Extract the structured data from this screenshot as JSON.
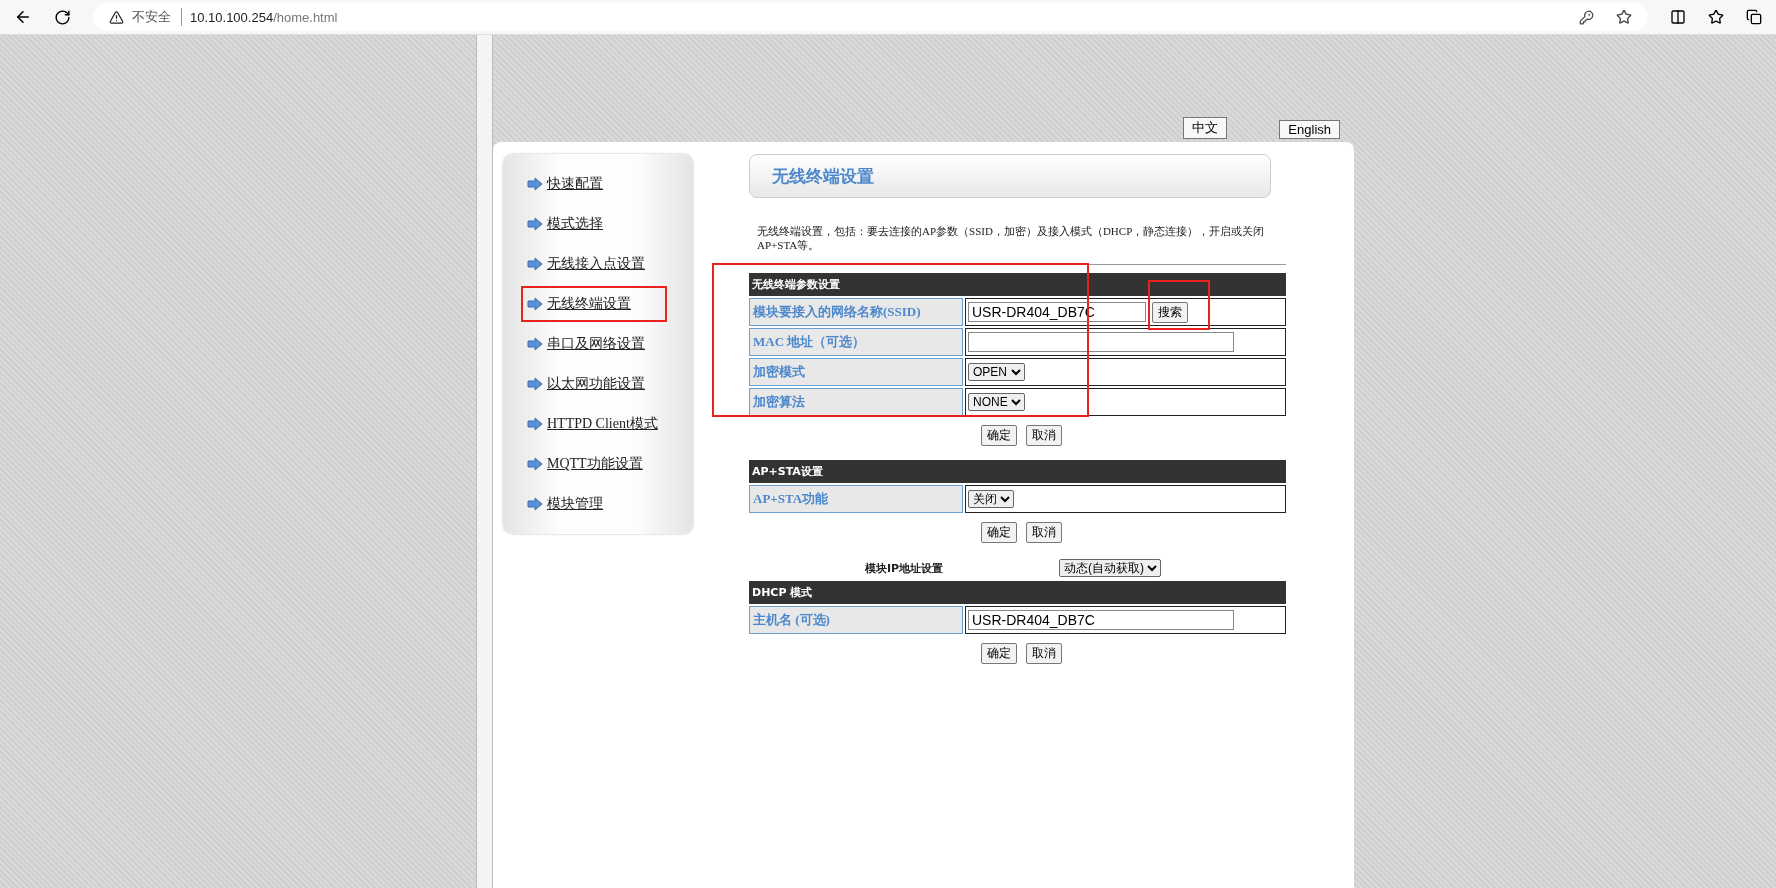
{
  "browser": {
    "security_label": "不安全",
    "url_host": "10.10.100.254",
    "url_path": "/home.html"
  },
  "language_buttons": [
    "中文",
    "English"
  ],
  "sidebar": {
    "items": [
      {
        "label": "快速配置",
        "highlighted": false
      },
      {
        "label": "模式选择",
        "highlighted": false
      },
      {
        "label": "无线接入点设置",
        "highlighted": false
      },
      {
        "label": "无线终端设置",
        "highlighted": true
      },
      {
        "label": "串口及网络设置",
        "highlighted": false
      },
      {
        "label": "以太网功能设置",
        "highlighted": false
      },
      {
        "label": "HTTPD Client模式",
        "highlighted": false
      },
      {
        "label": "MQTT功能设置",
        "highlighted": false
      },
      {
        "label": "模块管理",
        "highlighted": false
      }
    ]
  },
  "page_title": "无线终端设置",
  "description": "无线终端设置，包括：要去连接的AP参数（SSID，加密）及接入模式（DHCP，静态连接），开启或关闭 AP+STA等。",
  "sections": [
    {
      "title": "无线终端参数设置",
      "highlighted": true,
      "rows": [
        {
          "label": "模块要接入的网络名称(SSID)",
          "kind": "text",
          "value": "USR-DR404_DB7C",
          "button": "搜索",
          "button_highlighted": true
        },
        {
          "label": "MAC 地址（可选）",
          "kind": "text",
          "value": ""
        },
        {
          "label": "加密模式",
          "kind": "select",
          "value": "OPEN"
        },
        {
          "label": "加密算法",
          "kind": "select",
          "value": "NONE"
        }
      ],
      "buttons": [
        "确定",
        "取消"
      ]
    },
    {
      "title": "AP+STA设置",
      "highlighted": false,
      "rows": [
        {
          "label": "AP+STA功能",
          "kind": "select",
          "value": "关闭"
        }
      ],
      "buttons": [
        "确定",
        "取消"
      ]
    }
  ],
  "ip_setting": {
    "label": "模块IP地址设置",
    "value": "动态(自动获取)"
  },
  "dhcp_section": {
    "title": "DHCP 模式",
    "highlighted": false,
    "rows": [
      {
        "label": "主机名 (可选)",
        "kind": "text",
        "value": "USR-DR404_DB7C"
      }
    ],
    "buttons": [
      "确定",
      "取消"
    ]
  }
}
